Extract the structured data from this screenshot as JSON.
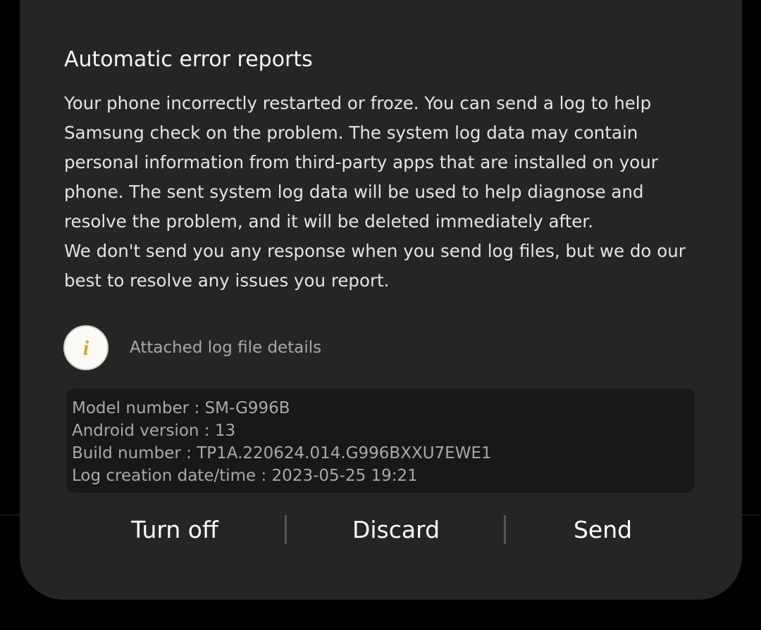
{
  "dialog": {
    "title": "Automatic error reports",
    "body_lines": [
      "Your phone incorrectly restarted or froze. You can send a log to help",
      "Samsung check on the problem. The system log data may contain",
      "personal information from third-party apps that are installed on your",
      "phone. The sent system log data will be used to help diagnose and",
      "resolve the problem, and it will be deleted immediately after.",
      "We don't send you any response when you send log files, but we do our",
      "best to resolve any issues you report."
    ],
    "info": {
      "icon": "info-icon",
      "icon_glyph": "i",
      "label": "Attached log file details"
    },
    "log_details": [
      "Model number : SM-G996B",
      "Android version : 13",
      "Build number : TP1A.220624.014.G996BXXU7EWE1",
      "Log creation date/time : 2023-05-25 19:21"
    ],
    "buttons": {
      "turn_off": "Turn off",
      "discard": "Discard",
      "send": "Send"
    }
  },
  "colors": {
    "dialog_bg": "#252525",
    "log_box_bg": "#181818",
    "info_icon_accent": "#e0a11b"
  }
}
